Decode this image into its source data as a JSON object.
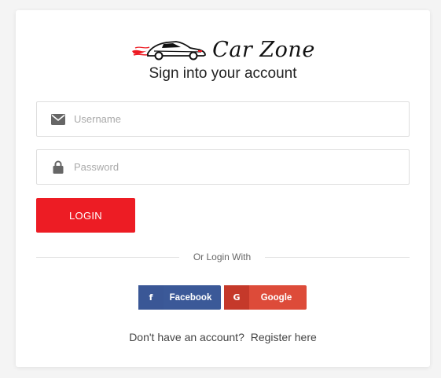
{
  "brand": {
    "name": "Car Zone",
    "colors": {
      "accent": "#ed1c24",
      "facebook": "#3b5998",
      "google": "#dd4b39"
    }
  },
  "form": {
    "heading": "Sign into your account",
    "username": {
      "placeholder": "Username",
      "value": "",
      "icon": "envelope-icon"
    },
    "password": {
      "placeholder": "Password",
      "value": "",
      "icon": "lock-icon"
    },
    "login_label": "LOGIN"
  },
  "divider": {
    "text": "Or Login With"
  },
  "social": {
    "facebook": {
      "icon_glyph": "f",
      "label": "Facebook",
      "icon": "facebook-icon"
    },
    "google": {
      "icon_glyph": "G",
      "label": "Google",
      "icon": "google-icon"
    }
  },
  "register": {
    "prompt": "Don't have an account?",
    "link_label": "Register here"
  }
}
